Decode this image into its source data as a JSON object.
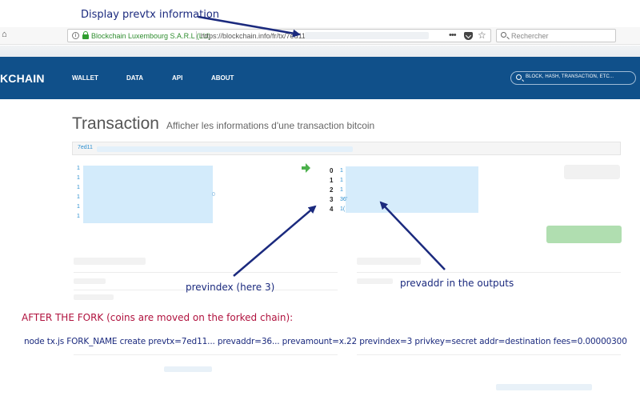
{
  "annotations": {
    "top_label": "Display prevtx information",
    "previndex_label": "previndex (here 3)",
    "prevaddr_label": "prevaddr in the outputs",
    "fork_note": "AFTER THE FORK (coins are moved on the forked chain):",
    "command": "node tx.js FORK_NAME create prevtx=7ed11... prevaddr=36... prevamount=x.22 previndex=3 privkey=secret addr=destination fees=0.00000300"
  },
  "browser": {
    "site_identity": "Blockchain Luxembourg S.A.R.L (LU)",
    "url": "https://blockchain.info/fr/tx/7ed11",
    "search_placeholder": "Rechercher",
    "overflow_menu": "•••",
    "bookmark_star": "☆",
    "home_symbol": "⌂",
    "info_symbol": "i"
  },
  "site": {
    "brand": "KCHAIN",
    "nav": [
      "WALLET",
      "DATA",
      "API",
      "ABOUT"
    ],
    "search_placeholder": "BLOCK, HASH, TRANSACTION, ETC..."
  },
  "page": {
    "title": "Transaction",
    "subtitle": "Afficher les informations d'une transaction bitcoin",
    "tx_hash_prefix": "7ed11"
  },
  "inputs": [
    "1",
    "1",
    "1",
    "1",
    "1",
    "1"
  ],
  "inputs_tail": "0",
  "outputs": [
    {
      "index": "0",
      "addr": "1"
    },
    {
      "index": "1",
      "addr": "1"
    },
    {
      "index": "2",
      "addr": "1"
    },
    {
      "index": "3",
      "addr": "36'"
    },
    {
      "index": "4",
      "addr": "1("
    }
  ],
  "colors": {
    "nav_bg": "#10508a",
    "link": "#2b8fd0",
    "annotation_navy": "#1b2a7e",
    "fork_red": "#b0123e",
    "arrow_green": "#4bb04b"
  }
}
